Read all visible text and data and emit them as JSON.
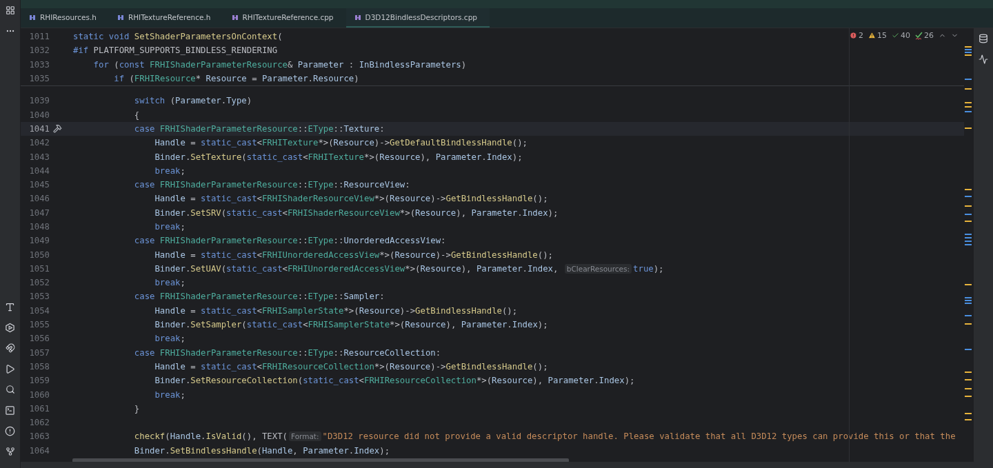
{
  "tabs": [
    {
      "label": "RHIResources.h",
      "kind": "header",
      "selected": false
    },
    {
      "label": "RHITextureReference.h",
      "kind": "header",
      "selected": false
    },
    {
      "label": "RHITextureReference.cpp",
      "kind": "source",
      "selected": false
    },
    {
      "label": "D3D12BindlessDescriptors.cpp",
      "kind": "source",
      "selected": true
    }
  ],
  "inspections": [
    {
      "kind": "error",
      "count": "2"
    },
    {
      "kind": "warning",
      "count": "15"
    },
    {
      "kind": "ok",
      "count": "40"
    },
    {
      "kind": "typo",
      "count": "26"
    }
  ],
  "sticky_lines": [
    {
      "number": "1011",
      "tokens": [
        {
          "kind": "kw",
          "text": "static void"
        },
        {
          "kind": "fn",
          "text": " SetShaderParametersOnContext"
        },
        {
          "kind": "p",
          "text": "("
        }
      ]
    },
    {
      "number": "1032",
      "tokens": [
        {
          "kind": "kw",
          "text": "#if"
        },
        {
          "kind": "p",
          "text": " PLATFORM_SUPPORTS_BINDLESS_RENDERING"
        }
      ]
    },
    {
      "number": "1033",
      "tokens": [
        {
          "kind": "kw",
          "text": "    for"
        },
        {
          "kind": "p",
          "text": " ("
        },
        {
          "kind": "kw",
          "text": "const"
        },
        {
          "kind": "ty",
          "text": " FRHIShaderParameterResource"
        },
        {
          "kind": "p",
          "text": "& "
        },
        {
          "kind": "id",
          "text": "Parameter"
        },
        {
          "kind": "p",
          "text": " : "
        },
        {
          "kind": "id",
          "text": "InBindlessParameters"
        },
        {
          "kind": "p",
          "text": ")"
        }
      ]
    },
    {
      "number": "1035",
      "tokens": [
        {
          "kind": "kw",
          "text": "        if"
        },
        {
          "kind": "p",
          "text": " ("
        },
        {
          "kind": "ty",
          "text": "FRHIResource"
        },
        {
          "kind": "p",
          "text": "* "
        },
        {
          "kind": "id",
          "text": "Resource"
        },
        {
          "kind": "p",
          "text": " = "
        },
        {
          "kind": "id",
          "text": "Parameter"
        },
        {
          "kind": "p",
          "text": "."
        },
        {
          "kind": "id",
          "text": "Resource"
        },
        {
          "kind": "p",
          "text": ")"
        }
      ]
    }
  ],
  "lines": [
    {
      "number": "1039",
      "current": false,
      "tokens": [
        {
          "kind": "kw",
          "text": "            switch"
        },
        {
          "kind": "p",
          "text": " ("
        },
        {
          "kind": "id",
          "text": "Parameter"
        },
        {
          "kind": "p",
          "text": "."
        },
        {
          "kind": "id",
          "text": "Type"
        },
        {
          "kind": "p",
          "text": ")"
        }
      ]
    },
    {
      "number": "1040",
      "current": false,
      "tokens": [
        {
          "kind": "p",
          "text": "            {"
        }
      ]
    },
    {
      "number": "1041",
      "current": true,
      "tokens": [
        {
          "kind": "kw",
          "text": "            case"
        },
        {
          "kind": "ty",
          "text": " FRHIShaderParameterResource"
        },
        {
          "kind": "p",
          "text": "::"
        },
        {
          "kind": "ty",
          "text": "EType"
        },
        {
          "kind": "p",
          "text": "::"
        },
        {
          "kind": "id",
          "text": "Texture"
        },
        {
          "kind": "p",
          "text": ":"
        }
      ]
    },
    {
      "number": "1042",
      "current": false,
      "tokens": [
        {
          "kind": "id",
          "text": "                Handle"
        },
        {
          "kind": "p",
          "text": " = "
        },
        {
          "kind": "kw",
          "text": "static_cast"
        },
        {
          "kind": "p",
          "text": "<"
        },
        {
          "kind": "ty",
          "text": "FRHITexture"
        },
        {
          "kind": "p",
          "text": "*>("
        },
        {
          "kind": "id",
          "text": "Resource"
        },
        {
          "kind": "p",
          "text": ")->"
        },
        {
          "kind": "fn",
          "text": "GetDefaultBindlessHandle"
        },
        {
          "kind": "p",
          "text": "();"
        }
      ]
    },
    {
      "number": "1043",
      "current": false,
      "tokens": [
        {
          "kind": "id",
          "text": "                Binder"
        },
        {
          "kind": "p",
          "text": "."
        },
        {
          "kind": "fn",
          "text": "SetTexture"
        },
        {
          "kind": "p",
          "text": "("
        },
        {
          "kind": "kw",
          "text": "static_cast"
        },
        {
          "kind": "p",
          "text": "<"
        },
        {
          "kind": "ty",
          "text": "FRHITexture"
        },
        {
          "kind": "p",
          "text": "*>("
        },
        {
          "kind": "id",
          "text": "Resource"
        },
        {
          "kind": "p",
          "text": "), "
        },
        {
          "kind": "id",
          "text": "Parameter"
        },
        {
          "kind": "p",
          "text": "."
        },
        {
          "kind": "id",
          "text": "Index"
        },
        {
          "kind": "p",
          "text": ");"
        }
      ]
    },
    {
      "number": "1044",
      "current": false,
      "tokens": [
        {
          "kind": "kw",
          "text": "                break"
        },
        {
          "kind": "p",
          "text": ";"
        }
      ]
    },
    {
      "number": "1045",
      "current": false,
      "tokens": [
        {
          "kind": "kw",
          "text": "            case"
        },
        {
          "kind": "ty",
          "text": " FRHIShaderParameterResource"
        },
        {
          "kind": "p",
          "text": "::"
        },
        {
          "kind": "ty",
          "text": "EType"
        },
        {
          "kind": "p",
          "text": "::"
        },
        {
          "kind": "id",
          "text": "ResourceView"
        },
        {
          "kind": "p",
          "text": ":"
        }
      ]
    },
    {
      "number": "1046",
      "current": false,
      "tokens": [
        {
          "kind": "id",
          "text": "                Handle"
        },
        {
          "kind": "p",
          "text": " = "
        },
        {
          "kind": "kw",
          "text": "static_cast"
        },
        {
          "kind": "p",
          "text": "<"
        },
        {
          "kind": "ty",
          "text": "FRHIShaderResourceView"
        },
        {
          "kind": "p",
          "text": "*>("
        },
        {
          "kind": "id",
          "text": "Resource"
        },
        {
          "kind": "p",
          "text": ")->"
        },
        {
          "kind": "fn",
          "text": "GetBindlessHandle"
        },
        {
          "kind": "p",
          "text": "();"
        }
      ]
    },
    {
      "number": "1047",
      "current": false,
      "tokens": [
        {
          "kind": "id",
          "text": "                Binder"
        },
        {
          "kind": "p",
          "text": "."
        },
        {
          "kind": "fn",
          "text": "SetSRV"
        },
        {
          "kind": "p",
          "text": "("
        },
        {
          "kind": "kw",
          "text": "static_cast"
        },
        {
          "kind": "p",
          "text": "<"
        },
        {
          "kind": "ty",
          "text": "FRHIShaderResourceView"
        },
        {
          "kind": "p",
          "text": "*>("
        },
        {
          "kind": "id",
          "text": "Resource"
        },
        {
          "kind": "p",
          "text": "), "
        },
        {
          "kind": "id",
          "text": "Parameter"
        },
        {
          "kind": "p",
          "text": "."
        },
        {
          "kind": "id",
          "text": "Index"
        },
        {
          "kind": "p",
          "text": ");"
        }
      ]
    },
    {
      "number": "1048",
      "current": false,
      "tokens": [
        {
          "kind": "kw",
          "text": "                break"
        },
        {
          "kind": "p",
          "text": ";"
        }
      ]
    },
    {
      "number": "1049",
      "current": false,
      "tokens": [
        {
          "kind": "kw",
          "text": "            case"
        },
        {
          "kind": "ty",
          "text": " FRHIShaderParameterResource"
        },
        {
          "kind": "p",
          "text": "::"
        },
        {
          "kind": "ty",
          "text": "EType"
        },
        {
          "kind": "p",
          "text": "::"
        },
        {
          "kind": "id",
          "text": "UnorderedAccessView"
        },
        {
          "kind": "p",
          "text": ":"
        }
      ]
    },
    {
      "number": "1050",
      "current": false,
      "tokens": [
        {
          "kind": "id",
          "text": "                Handle"
        },
        {
          "kind": "p",
          "text": " = "
        },
        {
          "kind": "kw",
          "text": "static_cast"
        },
        {
          "kind": "p",
          "text": "<"
        },
        {
          "kind": "ty",
          "text": "FRHIUnorderedAccessView"
        },
        {
          "kind": "p",
          "text": "*>("
        },
        {
          "kind": "id",
          "text": "Resource"
        },
        {
          "kind": "p",
          "text": ")->"
        },
        {
          "kind": "fn",
          "text": "GetBindlessHandle"
        },
        {
          "kind": "p",
          "text": "();"
        }
      ]
    },
    {
      "number": "1051",
      "current": false,
      "tokens": [
        {
          "kind": "id",
          "text": "                Binder"
        },
        {
          "kind": "p",
          "text": "."
        },
        {
          "kind": "fn",
          "text": "SetUAV"
        },
        {
          "kind": "p",
          "text": "("
        },
        {
          "kind": "kw",
          "text": "static_cast"
        },
        {
          "kind": "p",
          "text": "<"
        },
        {
          "kind": "ty",
          "text": "FRHIUnorderedAccessView"
        },
        {
          "kind": "p",
          "text": "*>("
        },
        {
          "kind": "id",
          "text": "Resource"
        },
        {
          "kind": "p",
          "text": "), "
        },
        {
          "kind": "id",
          "text": "Parameter"
        },
        {
          "kind": "p",
          "text": "."
        },
        {
          "kind": "id",
          "text": "Index"
        },
        {
          "kind": "p",
          "text": ", "
        },
        {
          "kind": "hint",
          "text": "bClearResources:"
        },
        {
          "kind": "kw",
          "text": "true"
        },
        {
          "kind": "p",
          "text": ");"
        }
      ]
    },
    {
      "number": "1052",
      "current": false,
      "tokens": [
        {
          "kind": "kw",
          "text": "                break"
        },
        {
          "kind": "p",
          "text": ";"
        }
      ]
    },
    {
      "number": "1053",
      "current": false,
      "tokens": [
        {
          "kind": "kw",
          "text": "            case"
        },
        {
          "kind": "ty",
          "text": " FRHIShaderParameterResource"
        },
        {
          "kind": "p",
          "text": "::"
        },
        {
          "kind": "ty",
          "text": "EType"
        },
        {
          "kind": "p",
          "text": "::"
        },
        {
          "kind": "id",
          "text": "Sampler"
        },
        {
          "kind": "p",
          "text": ":"
        }
      ]
    },
    {
      "number": "1054",
      "current": false,
      "tokens": [
        {
          "kind": "id",
          "text": "                Handle"
        },
        {
          "kind": "p",
          "text": " = "
        },
        {
          "kind": "kw",
          "text": "static_cast"
        },
        {
          "kind": "p",
          "text": "<"
        },
        {
          "kind": "ty",
          "text": "FRHISamplerState"
        },
        {
          "kind": "p",
          "text": "*>("
        },
        {
          "kind": "id",
          "text": "Resource"
        },
        {
          "kind": "p",
          "text": ")->"
        },
        {
          "kind": "fn",
          "text": "GetBindlessHandle"
        },
        {
          "kind": "p",
          "text": "();"
        }
      ]
    },
    {
      "number": "1055",
      "current": false,
      "tokens": [
        {
          "kind": "id",
          "text": "                Binder"
        },
        {
          "kind": "p",
          "text": "."
        },
        {
          "kind": "fn",
          "text": "SetSampler"
        },
        {
          "kind": "p",
          "text": "("
        },
        {
          "kind": "kw",
          "text": "static_cast"
        },
        {
          "kind": "p",
          "text": "<"
        },
        {
          "kind": "ty",
          "text": "FRHISamplerState"
        },
        {
          "kind": "p",
          "text": "*>("
        },
        {
          "kind": "id",
          "text": "Resource"
        },
        {
          "kind": "p",
          "text": "), "
        },
        {
          "kind": "id",
          "text": "Parameter"
        },
        {
          "kind": "p",
          "text": "."
        },
        {
          "kind": "id",
          "text": "Index"
        },
        {
          "kind": "p",
          "text": ");"
        }
      ]
    },
    {
      "number": "1056",
      "current": false,
      "tokens": [
        {
          "kind": "kw",
          "text": "                break"
        },
        {
          "kind": "p",
          "text": ";"
        }
      ]
    },
    {
      "number": "1057",
      "current": false,
      "tokens": [
        {
          "kind": "kw",
          "text": "            case"
        },
        {
          "kind": "ty",
          "text": " FRHIShaderParameterResource"
        },
        {
          "kind": "p",
          "text": "::"
        },
        {
          "kind": "ty",
          "text": "EType"
        },
        {
          "kind": "p",
          "text": "::"
        },
        {
          "kind": "id",
          "text": "ResourceCollection"
        },
        {
          "kind": "p",
          "text": ":"
        }
      ]
    },
    {
      "number": "1058",
      "current": false,
      "tokens": [
        {
          "kind": "id",
          "text": "                Handle"
        },
        {
          "kind": "p",
          "text": " = "
        },
        {
          "kind": "kw",
          "text": "static_cast"
        },
        {
          "kind": "p",
          "text": "<"
        },
        {
          "kind": "ty",
          "text": "FRHIResourceCollection"
        },
        {
          "kind": "p",
          "text": "*>("
        },
        {
          "kind": "id",
          "text": "Resource"
        },
        {
          "kind": "p",
          "text": ")->"
        },
        {
          "kind": "fn",
          "text": "GetBindlessHandle"
        },
        {
          "kind": "p",
          "text": "();"
        }
      ]
    },
    {
      "number": "1059",
      "current": false,
      "tokens": [
        {
          "kind": "id",
          "text": "                Binder"
        },
        {
          "kind": "p",
          "text": "."
        },
        {
          "kind": "fn",
          "text": "SetResourceCollection"
        },
        {
          "kind": "p",
          "text": "("
        },
        {
          "kind": "kw",
          "text": "static_cast"
        },
        {
          "kind": "p",
          "text": "<"
        },
        {
          "kind": "ty",
          "text": "FRHIResourceCollection"
        },
        {
          "kind": "p",
          "text": "*>("
        },
        {
          "kind": "id",
          "text": "Resource"
        },
        {
          "kind": "p",
          "text": "), "
        },
        {
          "kind": "id",
          "text": "Parameter"
        },
        {
          "kind": "p",
          "text": "."
        },
        {
          "kind": "id",
          "text": "Index"
        },
        {
          "kind": "p",
          "text": ");"
        }
      ]
    },
    {
      "number": "1060",
      "current": false,
      "tokens": [
        {
          "kind": "kw",
          "text": "                break"
        },
        {
          "kind": "p",
          "text": ";"
        }
      ]
    },
    {
      "number": "1061",
      "current": false,
      "tokens": [
        {
          "kind": "p",
          "text": "            }"
        }
      ]
    },
    {
      "number": "1062",
      "current": false
    },
    {
      "number": "1063",
      "current": false,
      "tokens": [
        {
          "kind": "fn",
          "text": "            checkf"
        },
        {
          "kind": "p",
          "text": "("
        },
        {
          "kind": "id",
          "text": "Handle"
        },
        {
          "kind": "p",
          "text": "."
        },
        {
          "kind": "fn",
          "text": "IsValid"
        },
        {
          "kind": "p",
          "text": "(), TEXT("
        },
        {
          "kind": "hint",
          "text": "Format:"
        },
        {
          "kind": "s",
          "text": "\"D3D12 resource did not provide a valid descriptor handle. Please validate that all D3D12 types can provide this or that the"
        }
      ]
    },
    {
      "number": "1064",
      "current": false,
      "tokens": [
        {
          "kind": "id",
          "text": "            Binder"
        },
        {
          "kind": "p",
          "text": "."
        },
        {
          "kind": "fn",
          "text": "SetBindlessHandle"
        },
        {
          "kind": "p",
          "text": "("
        },
        {
          "kind": "id",
          "text": "Handle"
        },
        {
          "kind": "p",
          "text": ", "
        },
        {
          "kind": "id",
          "text": "Parameter"
        },
        {
          "kind": "p",
          "text": "."
        },
        {
          "kind": "id",
          "text": "Index"
        },
        {
          "kind": "p",
          "text": ");"
        }
      ]
    }
  ]
}
